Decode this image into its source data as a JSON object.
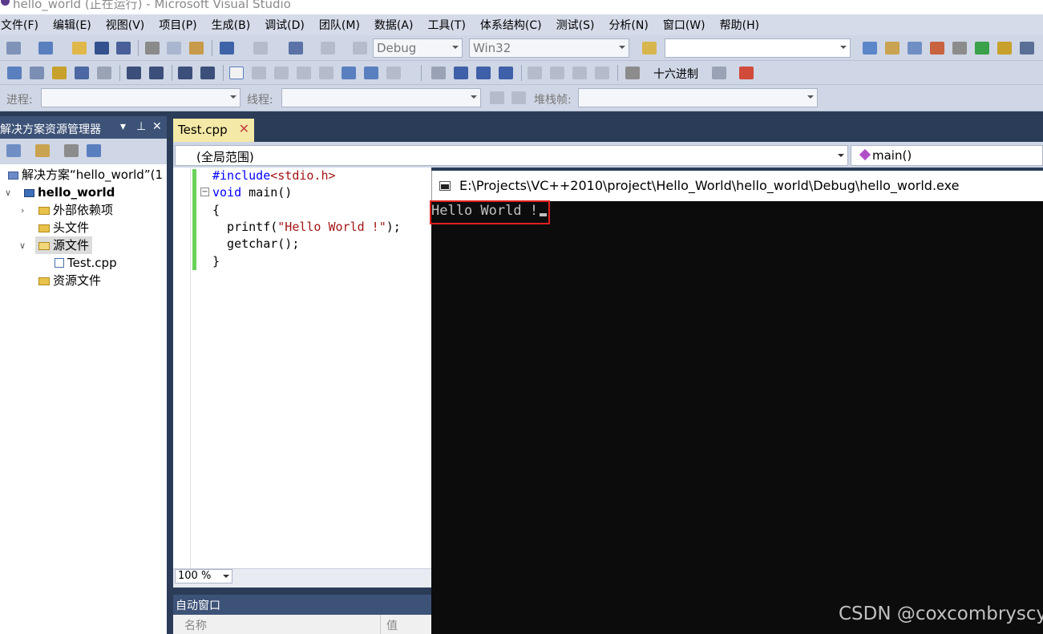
{
  "window": {
    "title": "hello_world (正在运行) - Microsoft Visual Studio"
  },
  "menu": [
    "文件(F)",
    "编辑(E)",
    "视图(V)",
    "项目(P)",
    "生成(B)",
    "调试(D)",
    "团队(M)",
    "数据(A)",
    "工具(T)",
    "体系结构(C)",
    "测试(S)",
    "分析(N)",
    "窗口(W)",
    "帮助(H)"
  ],
  "toolbar": {
    "config": "Debug",
    "platform": "Win32",
    "find_value": "",
    "hex_label": "十六进制",
    "process_label": "进程:",
    "thread_label": "线程:",
    "stackframe_label": "堆栈帧:"
  },
  "solution_explorer": {
    "title": "解决方案资源管理器",
    "solution": "解决方案“hello_world”(1",
    "project": "hello_world",
    "items": [
      "外部依赖项",
      "头文件",
      "源文件",
      "Test.cpp",
      "资源文件"
    ]
  },
  "editor": {
    "tab": "Test.cpp",
    "scope": "(全局范围)",
    "member": "main()",
    "zoom": "100 %",
    "code": [
      {
        "parts": [
          {
            "t": "#include",
            "c": "pp"
          },
          {
            "t": "<stdio.h>",
            "c": "inc"
          }
        ]
      },
      {
        "parts": [
          {
            "t": "void",
            "c": "kw"
          },
          {
            "t": " main()",
            "c": ""
          }
        ]
      },
      {
        "parts": [
          {
            "t": "{",
            "c": ""
          }
        ]
      },
      {
        "parts": [
          {
            "t": "  printf(",
            "c": ""
          },
          {
            "t": "\"Hello World !\"",
            "c": "str"
          },
          {
            "t": ");",
            "c": ""
          }
        ]
      },
      {
        "parts": [
          {
            "t": "  getchar();",
            "c": ""
          }
        ]
      },
      {
        "parts": [
          {
            "t": "}",
            "c": ""
          }
        ]
      }
    ]
  },
  "autos": {
    "title": "自动窗口",
    "col_name": "名称",
    "col_value": "值"
  },
  "console": {
    "title": "E:\\Projects\\VC++2010\\project\\Hello_World\\hello_world\\Debug\\hello_world.exe",
    "output": "Hello World !"
  },
  "watermark": "CSDN @coxcombryscy",
  "colors": {
    "accent_panel": "#3d5277",
    "tab_active": "#f4e9a6",
    "highlight_box": "#e02020",
    "console_bg": "#0c0c0c"
  }
}
